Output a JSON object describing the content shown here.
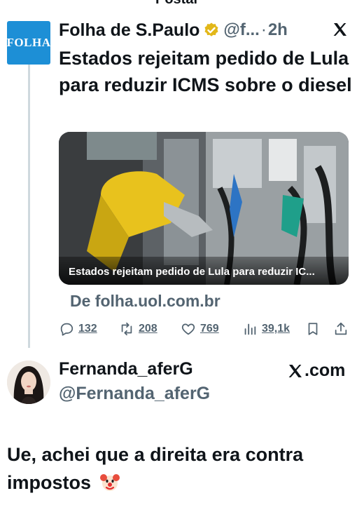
{
  "top_fragment": "Postar",
  "tweet": {
    "author_name": "Folha de S.Paulo",
    "avatar_text": "FOLHA",
    "handle": "@f...",
    "separator": "·",
    "time": "2h",
    "text": "Estados rejeitam pedido de Lula para reduzir ICMS sobre o diesel",
    "media_caption": "Estados rejeitam pedido de Lula para reduzir IC...",
    "link_source": "De folha.uol.com.br",
    "stats": {
      "replies": "132",
      "reposts": "208",
      "likes": "769",
      "views": "39,1k"
    }
  },
  "quote_author": {
    "name": "Fernanda_aferG",
    "handle": "@Fernanda_aferG",
    "site_label": ".com"
  },
  "post_text": "Ue, achei que a direita era contra impostos",
  "icons": {
    "verified": "verified-badge-icon",
    "x_logo": "x-logo-icon",
    "reply": "reply-icon",
    "repost": "repost-icon",
    "like": "heart-icon",
    "views": "views-icon",
    "bookmark": "bookmark-icon",
    "share": "share-icon",
    "emoji": "clown-face-emoji"
  },
  "colors": {
    "folha_blue": "#1d8fd6",
    "muted": "#536471",
    "text": "#0f1419",
    "verified_gold": "#e2b719"
  }
}
